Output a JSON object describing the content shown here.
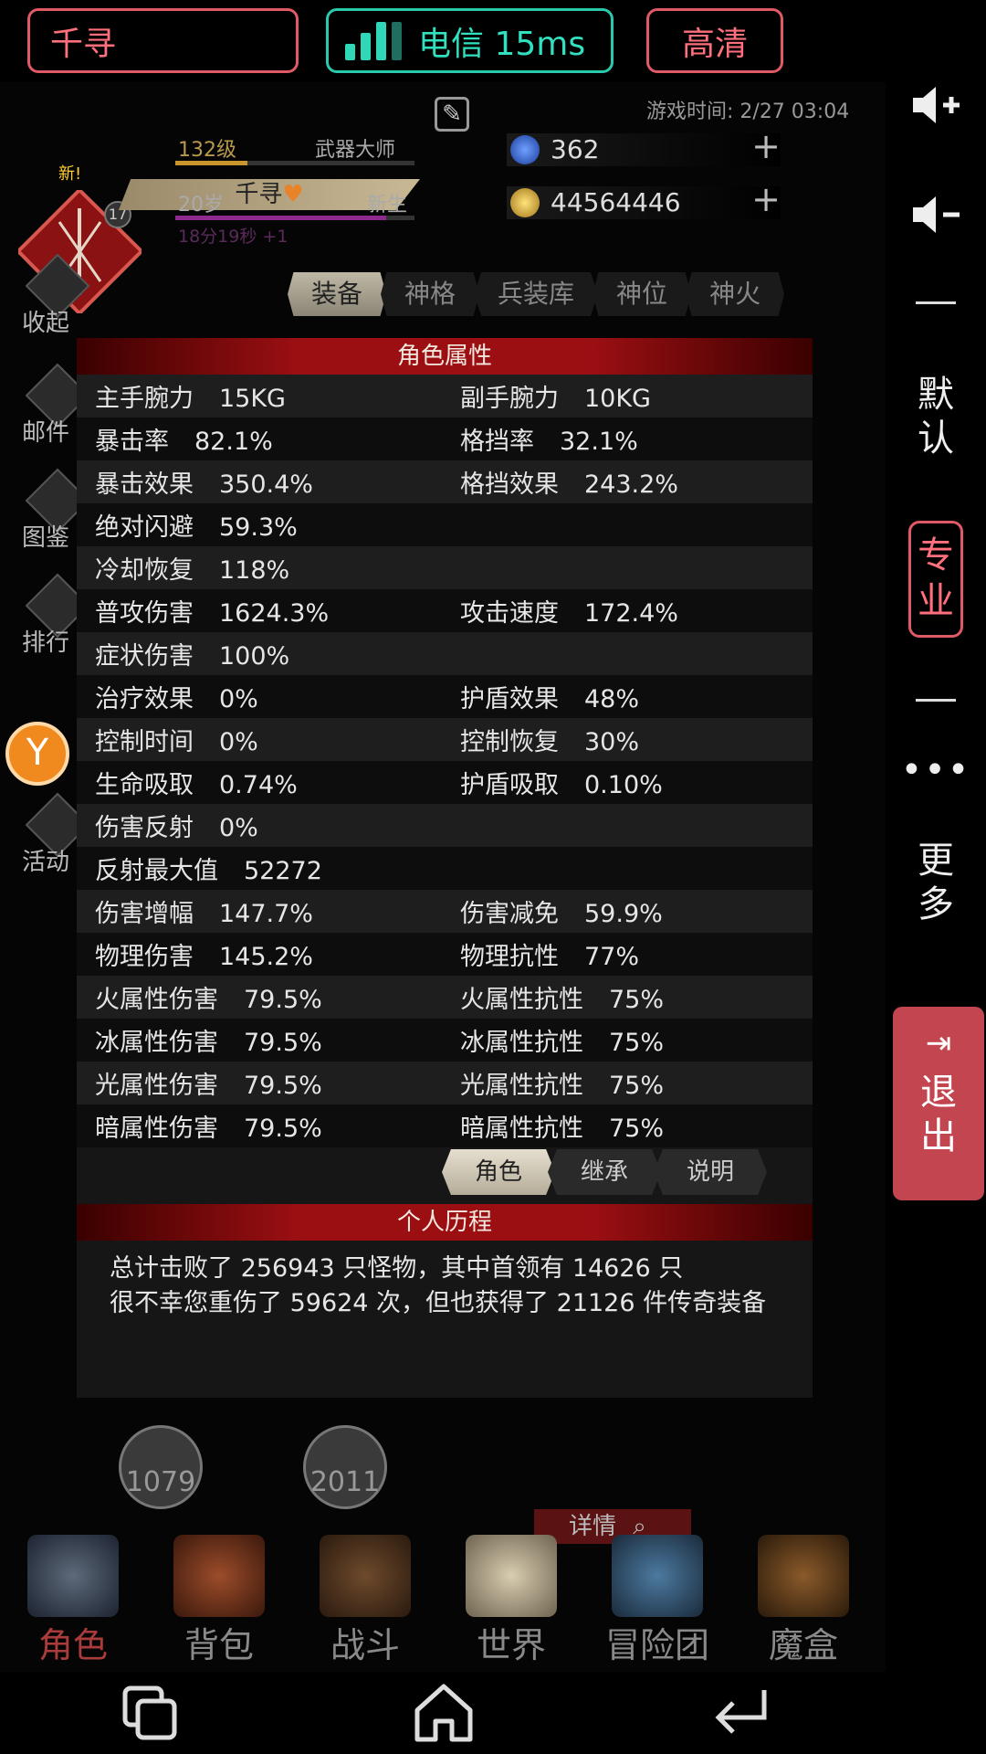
{
  "top": {
    "username": "千寻",
    "network": "电信 15ms",
    "quality": "高清"
  },
  "side": {
    "default": "默认",
    "pro": "专业",
    "more": "更多",
    "exit": "退出"
  },
  "player": {
    "name": "千寻",
    "level": "132级",
    "title": "武器大师",
    "age": "20岁",
    "stage": "新生",
    "timer": "18分19秒 +1",
    "badge_level": "17",
    "new_tag": "新!",
    "game_time": "游戏时间: 2/27 03:04",
    "gems": "362",
    "gold": "44564446"
  },
  "tabs": [
    "装备",
    "神格",
    "兵装库",
    "神位",
    "神火"
  ],
  "left_menu": [
    "收起",
    "邮件",
    "图鉴",
    "排行",
    "活动"
  ],
  "panel": {
    "title": "角色属性",
    "rows": [
      [
        {
          "k": "主手腕力",
          "v": "15KG"
        },
        {
          "k": "副手腕力",
          "v": "10KG"
        }
      ],
      [
        {
          "k": "暴击率",
          "v": "82.1%"
        },
        {
          "k": "格挡率",
          "v": "32.1%"
        }
      ],
      [
        {
          "k": "暴击效果",
          "v": "350.4%"
        },
        {
          "k": "格挡效果",
          "v": "243.2%"
        }
      ],
      [
        {
          "k": "绝对闪避",
          "v": "59.3%"
        },
        null
      ],
      [
        {
          "k": "冷却恢复",
          "v": "118%"
        },
        null
      ],
      [
        {
          "k": "普攻伤害",
          "v": "1624.3%"
        },
        {
          "k": "攻击速度",
          "v": "172.4%"
        }
      ],
      [
        {
          "k": "症状伤害",
          "v": "100%"
        },
        null
      ],
      [
        {
          "k": "治疗效果",
          "v": "0%"
        },
        {
          "k": "护盾效果",
          "v": "48%"
        }
      ],
      [
        {
          "k": "控制时间",
          "v": "0%"
        },
        {
          "k": "控制恢复",
          "v": "30%"
        }
      ],
      [
        {
          "k": "生命吸取",
          "v": "0.74%"
        },
        {
          "k": "护盾吸取",
          "v": "0.10%"
        }
      ],
      [
        {
          "k": "伤害反射",
          "v": "0%"
        },
        null
      ],
      [
        {
          "k": "反射最大值",
          "v": "52272"
        },
        null
      ],
      [
        {
          "k": "伤害增幅",
          "v": "147.7%"
        },
        {
          "k": "伤害减免",
          "v": "59.9%"
        }
      ],
      [
        {
          "k": "物理伤害",
          "v": "145.2%"
        },
        {
          "k": "物理抗性",
          "v": "77%"
        }
      ],
      [
        {
          "k": "火属性伤害",
          "v": "79.5%"
        },
        {
          "k": "火属性抗性",
          "v": "75%"
        }
      ],
      [
        {
          "k": "冰属性伤害",
          "v": "79.5%"
        },
        {
          "k": "冰属性抗性",
          "v": "75%"
        }
      ],
      [
        {
          "k": "光属性伤害",
          "v": "79.5%"
        },
        {
          "k": "光属性抗性",
          "v": "75%"
        }
      ],
      [
        {
          "k": "暗属性伤害",
          "v": "79.5%"
        },
        {
          "k": "暗属性抗性",
          "v": "75%"
        }
      ]
    ],
    "subtabs": [
      "角色",
      "继承",
      "说明"
    ],
    "history_title": "个人历程",
    "history_line1": "总计击败了 256943 只怪物，其中首领有 14626 只",
    "history_line2": "很不幸您重伤了 59624 次，但也获得了 21126 件传奇装备"
  },
  "below": {
    "clock1": "1079",
    "clock2": "2011",
    "detail": "详情"
  },
  "bottom_nav": [
    "角色",
    "背包",
    "战斗",
    "世界",
    "冒险团",
    "魔盒"
  ]
}
